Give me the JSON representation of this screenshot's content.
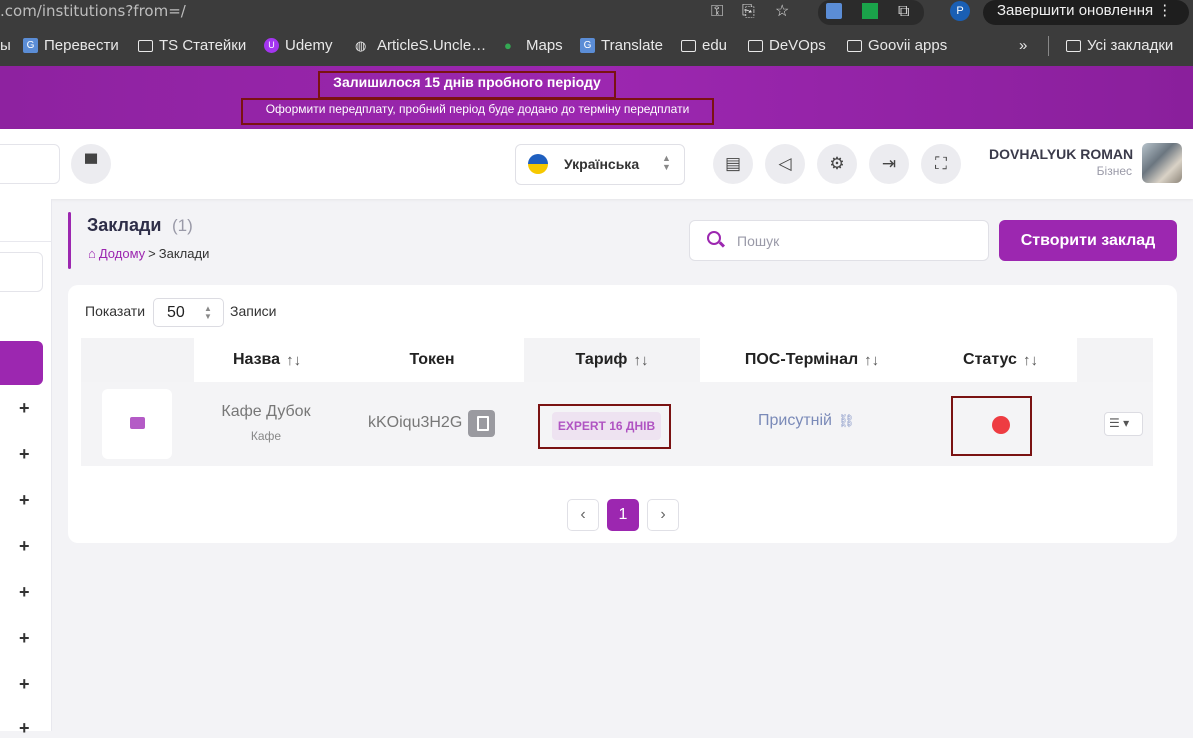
{
  "browser": {
    "url": ".com/institutions?from=/",
    "update_label": "Завершити оновлення",
    "profile_initial": "P"
  },
  "bookmarks": {
    "first_fragment": "ы",
    "items": [
      "Перевести",
      "TS Статейки",
      "Udemy",
      "ArticleS.Uncle…",
      "Maps",
      "Translate",
      "edu",
      "DeVOps",
      "Goovii apps"
    ],
    "more": "»",
    "all_label": "Усі закладки"
  },
  "banner": {
    "title": "Залишилося 15 днів пробного періоду",
    "subtitle": "Оформити передплату, пробний період буде додано до терміну передплати"
  },
  "topbar": {
    "language": "Українська",
    "user_name": "DOVHALYUK ROMAN",
    "user_role": "Бізнес"
  },
  "page": {
    "title": "Заклади",
    "count": "(1)",
    "breadcrumb_home": "Додому",
    "breadcrumb_sep": ">",
    "breadcrumb_current": "Заклади"
  },
  "search": {
    "placeholder": "Пошук"
  },
  "create_button": "Створити заклад",
  "table": {
    "show_label": "Показати",
    "page_size": "50",
    "records_label": "Записи",
    "headers": {
      "name": "Назва",
      "token": "Токен",
      "tariff": "Тариф",
      "pos": "ПОС-Термінал",
      "status": "Статус"
    },
    "sort_glyph": "↑↓",
    "rows": [
      {
        "name": "Кафе Дубок",
        "type": "Кафе",
        "token": "kKOiqu3H2G",
        "tariff": "EXPERT 16 ДНІВ",
        "pos": "Присутній",
        "status_color": "#ee3c42"
      }
    ]
  },
  "pagination": {
    "prev": "‹",
    "current": "1",
    "next": "›"
  },
  "colors": {
    "brand": "#9c27b0",
    "status_inactive": "#ee3c42"
  }
}
